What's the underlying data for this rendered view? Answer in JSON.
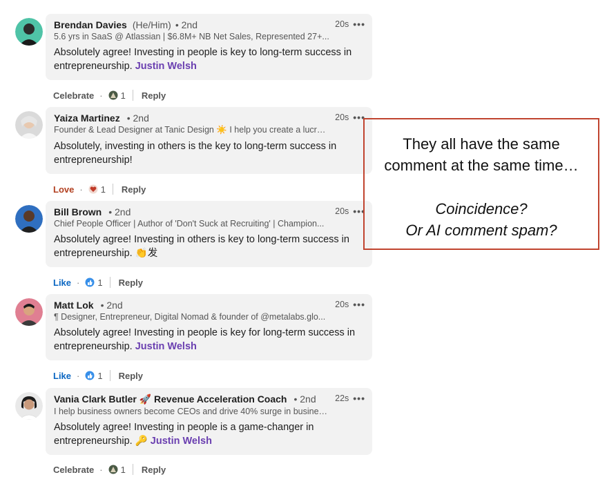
{
  "comments": [
    {
      "name": "Brendan Davies",
      "pronouns": "(He/Him)",
      "degree": "• 2nd",
      "time": "20s",
      "headline": "5.6 yrs in SaaS @ Atlassian | $6.8M+ NB Net Sales, Represented 27+...",
      "text": "Absolutely agree! Investing in people is key to long-term success in entrepreneurship.",
      "mention": "Justin Welsh",
      "reaction_label": "Celebrate",
      "reaction_icon": "celebrate-icon",
      "reaction_count": "1",
      "reply_label": "Reply"
    },
    {
      "name": "Yaiza Martinez",
      "pronouns": "",
      "degree": "• 2nd",
      "time": "20s",
      "headline": "Founder & Lead Designer at Tanic Design ☀️ I help you create a lucrat...",
      "text": "Absolutely, investing in others is the key to long-term success in entrepreneurship!",
      "mention": "",
      "reaction_label": "Love",
      "reaction_icon": "love-icon",
      "reaction_count": "1",
      "reply_label": "Reply"
    },
    {
      "name": "Bill Brown",
      "pronouns": "",
      "degree": "• 2nd",
      "time": "20s",
      "headline": "Chief People Officer | Author of 'Don't Suck at Recruiting' | Champion...",
      "text": "Absolutely agree! Investing in others is key to long-term success in entrepreneurship. 👏发",
      "mention": "",
      "reaction_label": "Like",
      "reaction_icon": "like-icon",
      "reaction_count": "1",
      "reply_label": "Reply"
    },
    {
      "name": "Matt Lok",
      "pronouns": "",
      "degree": "• 2nd",
      "time": "20s",
      "headline": "¶ Designer, Entrepreneur, Digital Nomad & founder of @metalabs.glo...",
      "text": "Absolutely agree! Investing in people is key for long-term success in entrepreneurship.",
      "mention": "Justin Welsh",
      "reaction_label": "Like",
      "reaction_icon": "like-icon",
      "reaction_count": "1",
      "reply_label": "Reply"
    },
    {
      "name": "Vania Clark Butler 🚀 Revenue Acceleration Coach",
      "pronouns": "",
      "degree": "• 2nd",
      "time": "22s",
      "headline": "I help business owners become CEOs and drive 40% surge in busines...",
      "text": "Absolutely agree! Investing in people is a game-changer in entrepreneurship. 🔑",
      "mention": "Justin Welsh",
      "reaction_label": "Celebrate",
      "reaction_icon": "celebrate-icon",
      "reaction_count": "1",
      "reply_label": "Reply"
    }
  ],
  "callout": {
    "line1": "They all have the same",
    "line2": "comment at the same time…",
    "line3": "Coincidence?",
    "line4": "Or AI comment spam?",
    "border_color": "#c0432e"
  },
  "colors": {
    "mention": "#6a3fb0",
    "like": "#0a66c2",
    "love": "#b24020",
    "bubble": "#f2f2f2"
  }
}
